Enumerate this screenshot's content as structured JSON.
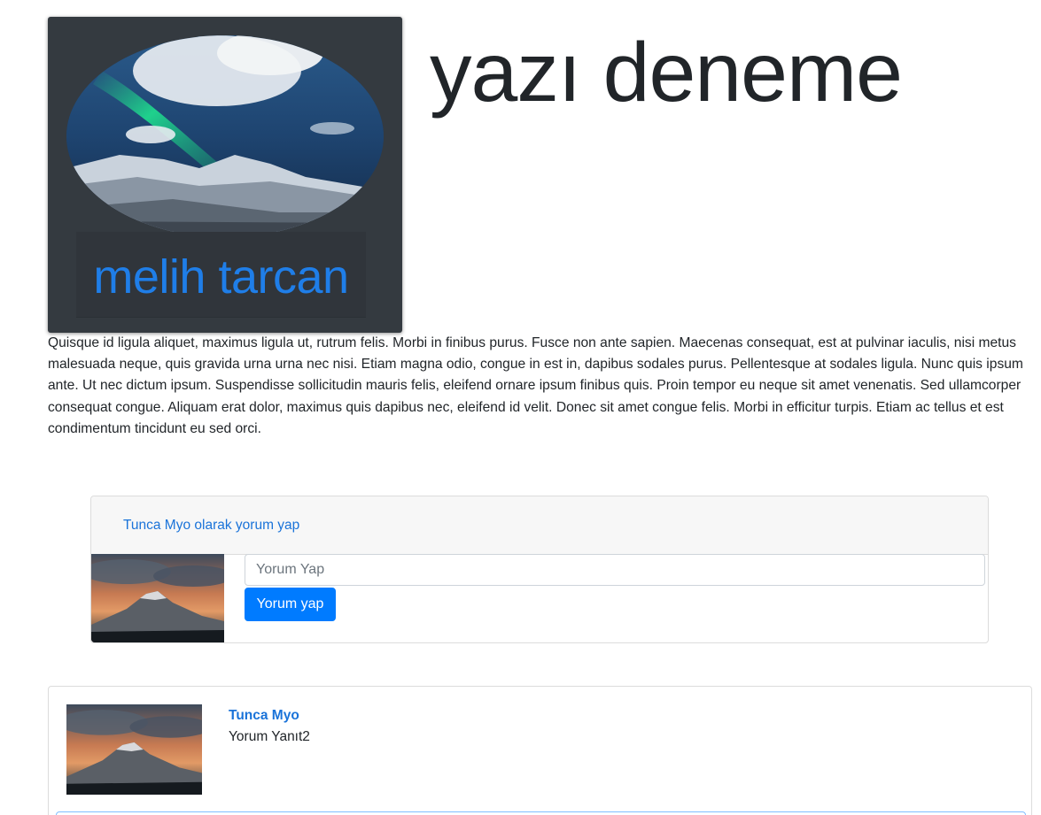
{
  "author": {
    "name": "melih tarcan"
  },
  "post": {
    "title": "yazı deneme",
    "body": "Quisque id ligula aliquet, maximus ligula ut, rutrum felis. Morbi in finibus purus. Fusce non ante sapien. Maecenas consequat, est at pulvinar iaculis, nisi metus malesuada neque, quis gravida urna urna nec nisi. Etiam magna odio, congue in est in, dapibus sodales purus. Pellentesque at sodales ligula. Nunc quis ipsum ante. Ut nec dictum ipsum. Suspendisse sollicitudin mauris felis, eleifend ornare ipsum finibus quis. Proin tempor eu neque sit amet venenatis. Sed ullamcorper consequat congue. Aliquam erat dolor, maximus quis dapibus nec, eleifend id velit. Donec sit amet congue felis. Morbi in efficitur turpis. Etiam ac tellus et est condimentum tincidunt eu sed orci."
  },
  "comment_form": {
    "header_link": "Tunca Myo olarak yorum yap",
    "input_placeholder": "Yorum Yap",
    "input_value": "",
    "submit_label": "Yorum yap"
  },
  "comments": [
    {
      "author": "Tunca Myo",
      "text": "Yorum Yanıt2"
    }
  ],
  "colors": {
    "accent": "#007bff",
    "link": "#1a73d9",
    "card_dark": "#343a40"
  },
  "icons": {
    "author_photo": "aurora-landscape-image",
    "user_avatar": "volcano-sunset-image"
  }
}
